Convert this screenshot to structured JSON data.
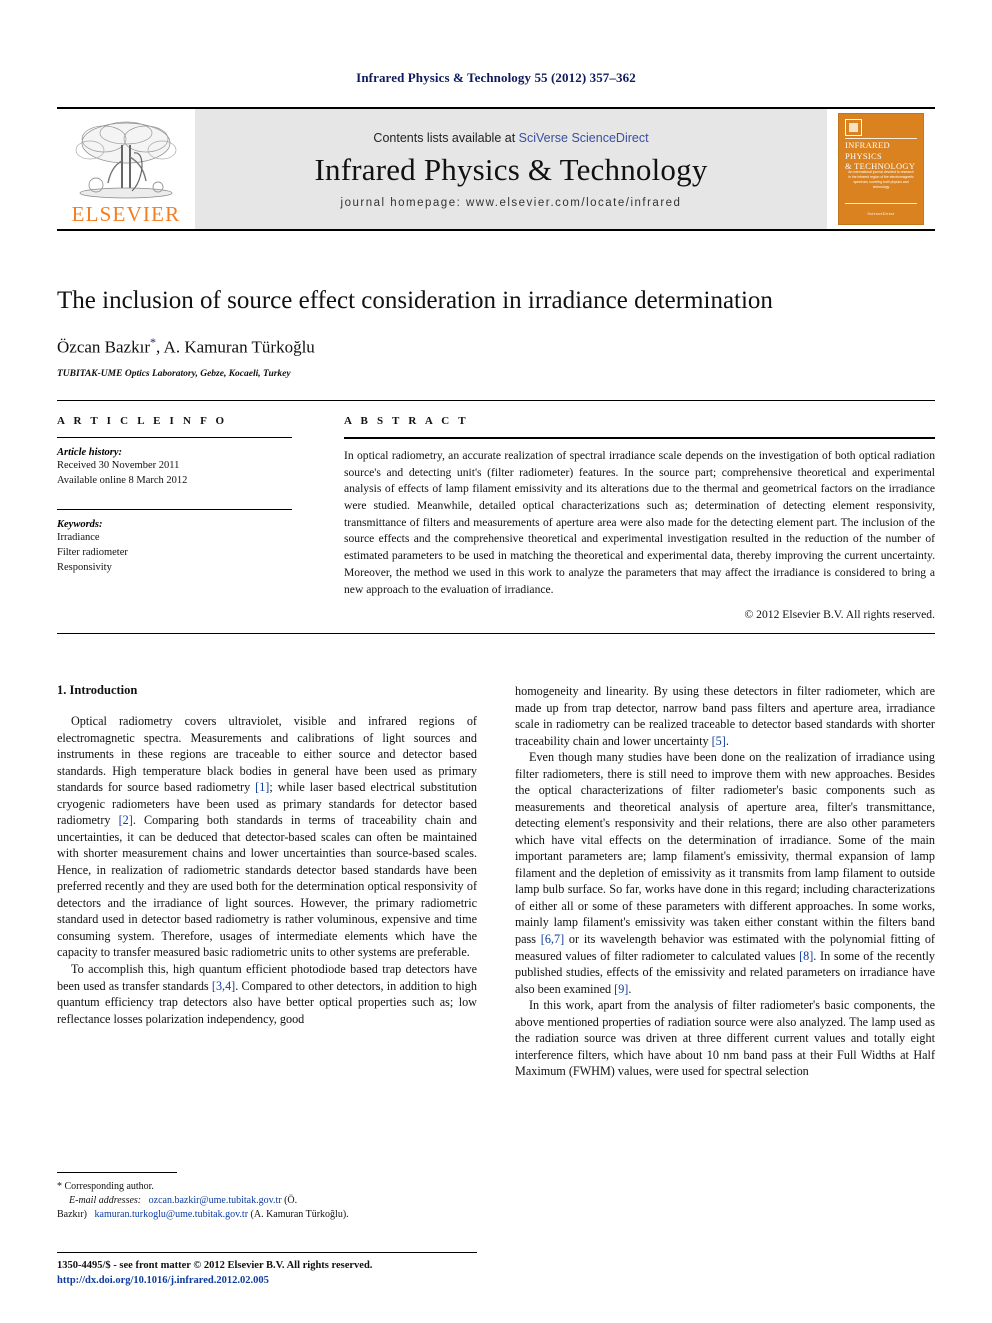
{
  "running_head": "Infrared Physics & Technology 55 (2012) 357–362",
  "masthead": {
    "publisher_name": "ELSEVIER",
    "contents_prefix": "Contents lists available at ",
    "contents_link": "SciVerse ScienceDirect",
    "journal_title": "Infrared Physics & Technology",
    "homepage": "journal homepage: www.elsevier.com/locate/infrared",
    "cover": {
      "title_line1": "INFRARED PHYSICS",
      "title_line2": "& TECHNOLOGY",
      "blurb": "An international journal devoted to research in the infrared region of the electromagnetic spectrum, covering both physics and technology",
      "footer": "ScienceDirect"
    }
  },
  "article": {
    "title": "The inclusion of source effect consideration in irradiance determination",
    "authors": "Özcan Bazkır",
    "author_marker": "*",
    "authors_rest": ", A. Kamuran Türkoğlu",
    "affiliation": "TUBITAK-UME Optics Laboratory, Gebze, Kocaeli, Turkey"
  },
  "info": {
    "heading": "A R T I C L E   I N F O",
    "history_label": "Article history:",
    "received": "Received 30 November 2011",
    "available": "Available online 8 March 2012",
    "keywords_label": "Keywords:",
    "keywords": [
      "Irradiance",
      "Filter radiometer",
      "Responsivity"
    ]
  },
  "abstract": {
    "heading": "A B S T R A C T",
    "text": "In optical radiometry, an accurate realization of spectral irradiance scale depends on the investigation of both optical radiation source's and detecting unit's (filter radiometer) features. In the source part; comprehensive theoretical and experimental analysis of effects of lamp filament emissivity and its alterations due to the thermal and geometrical factors on the irradiance were studied. Meanwhile, detailed optical characterizations such as; determination of detecting element responsivity, transmittance of filters and measurements of aperture area were also made for the detecting element part. The inclusion of the source effects and the comprehensive theoretical and experimental investigation resulted in the reduction of the number of estimated parameters to be used in matching the theoretical and experimental data, thereby improving the current uncertainty. Moreover, the method we used in this work to analyze the parameters that may affect the irradiance is considered to bring a new approach to the evaluation of irradiance.",
    "copyright": "© 2012 Elsevier B.V. All rights reserved."
  },
  "body": {
    "section_title": "1. Introduction",
    "left_paragraphs": [
      "Optical radiometry covers ultraviolet, visible and infrared regions of electromagnetic spectra. Measurements and calibrations of light sources and instruments in these regions are traceable to either source and detector based standards. High temperature black bodies in general have been used as primary standards for source based radiometry [1]; while laser based electrical substitution cryogenic radiometers have been used as primary standards for detector based radiometry [2]. Comparing both standards in terms of traceability chain and uncertainties, it can be deduced that detector-based scales can often be maintained with shorter measurement chains and lower uncertainties than source-based scales. Hence, in realization of radiometric standards detector based standards have been preferred recently and they are used both for the determination optical responsivity of detectors and the irradiance of light sources. However, the primary radiometric standard used in detector based radiometry is rather voluminous, expensive and time consuming system. Therefore, usages of intermediate elements which have the capacity to transfer measured basic radiometric units to other systems are preferable.",
      "To accomplish this, high quantum efficient photodiode based trap detectors have been used as transfer standards [3,4]. Compared to other detectors, in addition to high quantum efficiency trap detectors also have better optical properties such as; low reflectance losses polarization independency, good"
    ],
    "right_paragraphs": [
      "homogeneity and linearity. By using these detectors in filter radiometer, which are made up from trap detector, narrow band pass filters and aperture area, irradiance scale in radiometry can be realized traceable to detector based standards with shorter traceability chain and lower uncertainty [5].",
      "Even though many studies have been done on the realization of irradiance using filter radiometers, there is still need to improve them with new approaches. Besides the optical characterizations of filter radiometer's basic components such as measurements and theoretical analysis of aperture area, filter's transmittance, detecting element's responsivity and their relations, there are also other parameters which have vital effects on the determination of irradiance. Some of the main important parameters are; lamp filament's emissivity, thermal expansion of lamp filament and the depletion of emissivity as it transmits from lamp filament to outside lamp bulb surface. So far, works have done in this regard; including characterizations of either all or some of these parameters with different approaches. In some works, mainly lamp filament's emissivity was taken either constant within the filters band pass [6,7] or its wavelength behavior was estimated with the polynomial fitting of measured values of filter radiometer to calculated values [8]. In some of the recently published studies, effects of the emissivity and related parameters on irradiance have also been examined [9].",
      "In this work, apart from the analysis of filter radiometer's basic components, the above mentioned properties of radiation source were also analyzed. The lamp used as the radiation source was driven at three different current values and totally eight interference filters, which have about 10 nm band pass at their Full Widths at Half Maximum (FWHM) values, were used for spectral selection"
    ]
  },
  "footnote": {
    "corresponding": "* Corresponding author.",
    "email_label": "E-mail addresses:",
    "email1": "ozcan.bazkir@ume.tubitak.gov.tr",
    "email1_name": "(Ö. Bazkır)",
    "email2": "kamuran.turkoglu@ume.tubitak.gov.tr",
    "email2_name": "(A. Kamuran Türkoğlu)."
  },
  "footer": {
    "issn_line": "1350-4495/$ - see front matter © 2012 Elsevier B.V. All rights reserved.",
    "doi": "http://dx.doi.org/10.1016/j.infrared.2012.02.005"
  },
  "colors": {
    "running_head": "#0d1a5e",
    "link": "#3b4ea0",
    "reference": "#0d3b9e",
    "elsevier_orange": "#f47d20",
    "cover_orange": "#d9821f",
    "band_gray": "#e6e6e6"
  }
}
